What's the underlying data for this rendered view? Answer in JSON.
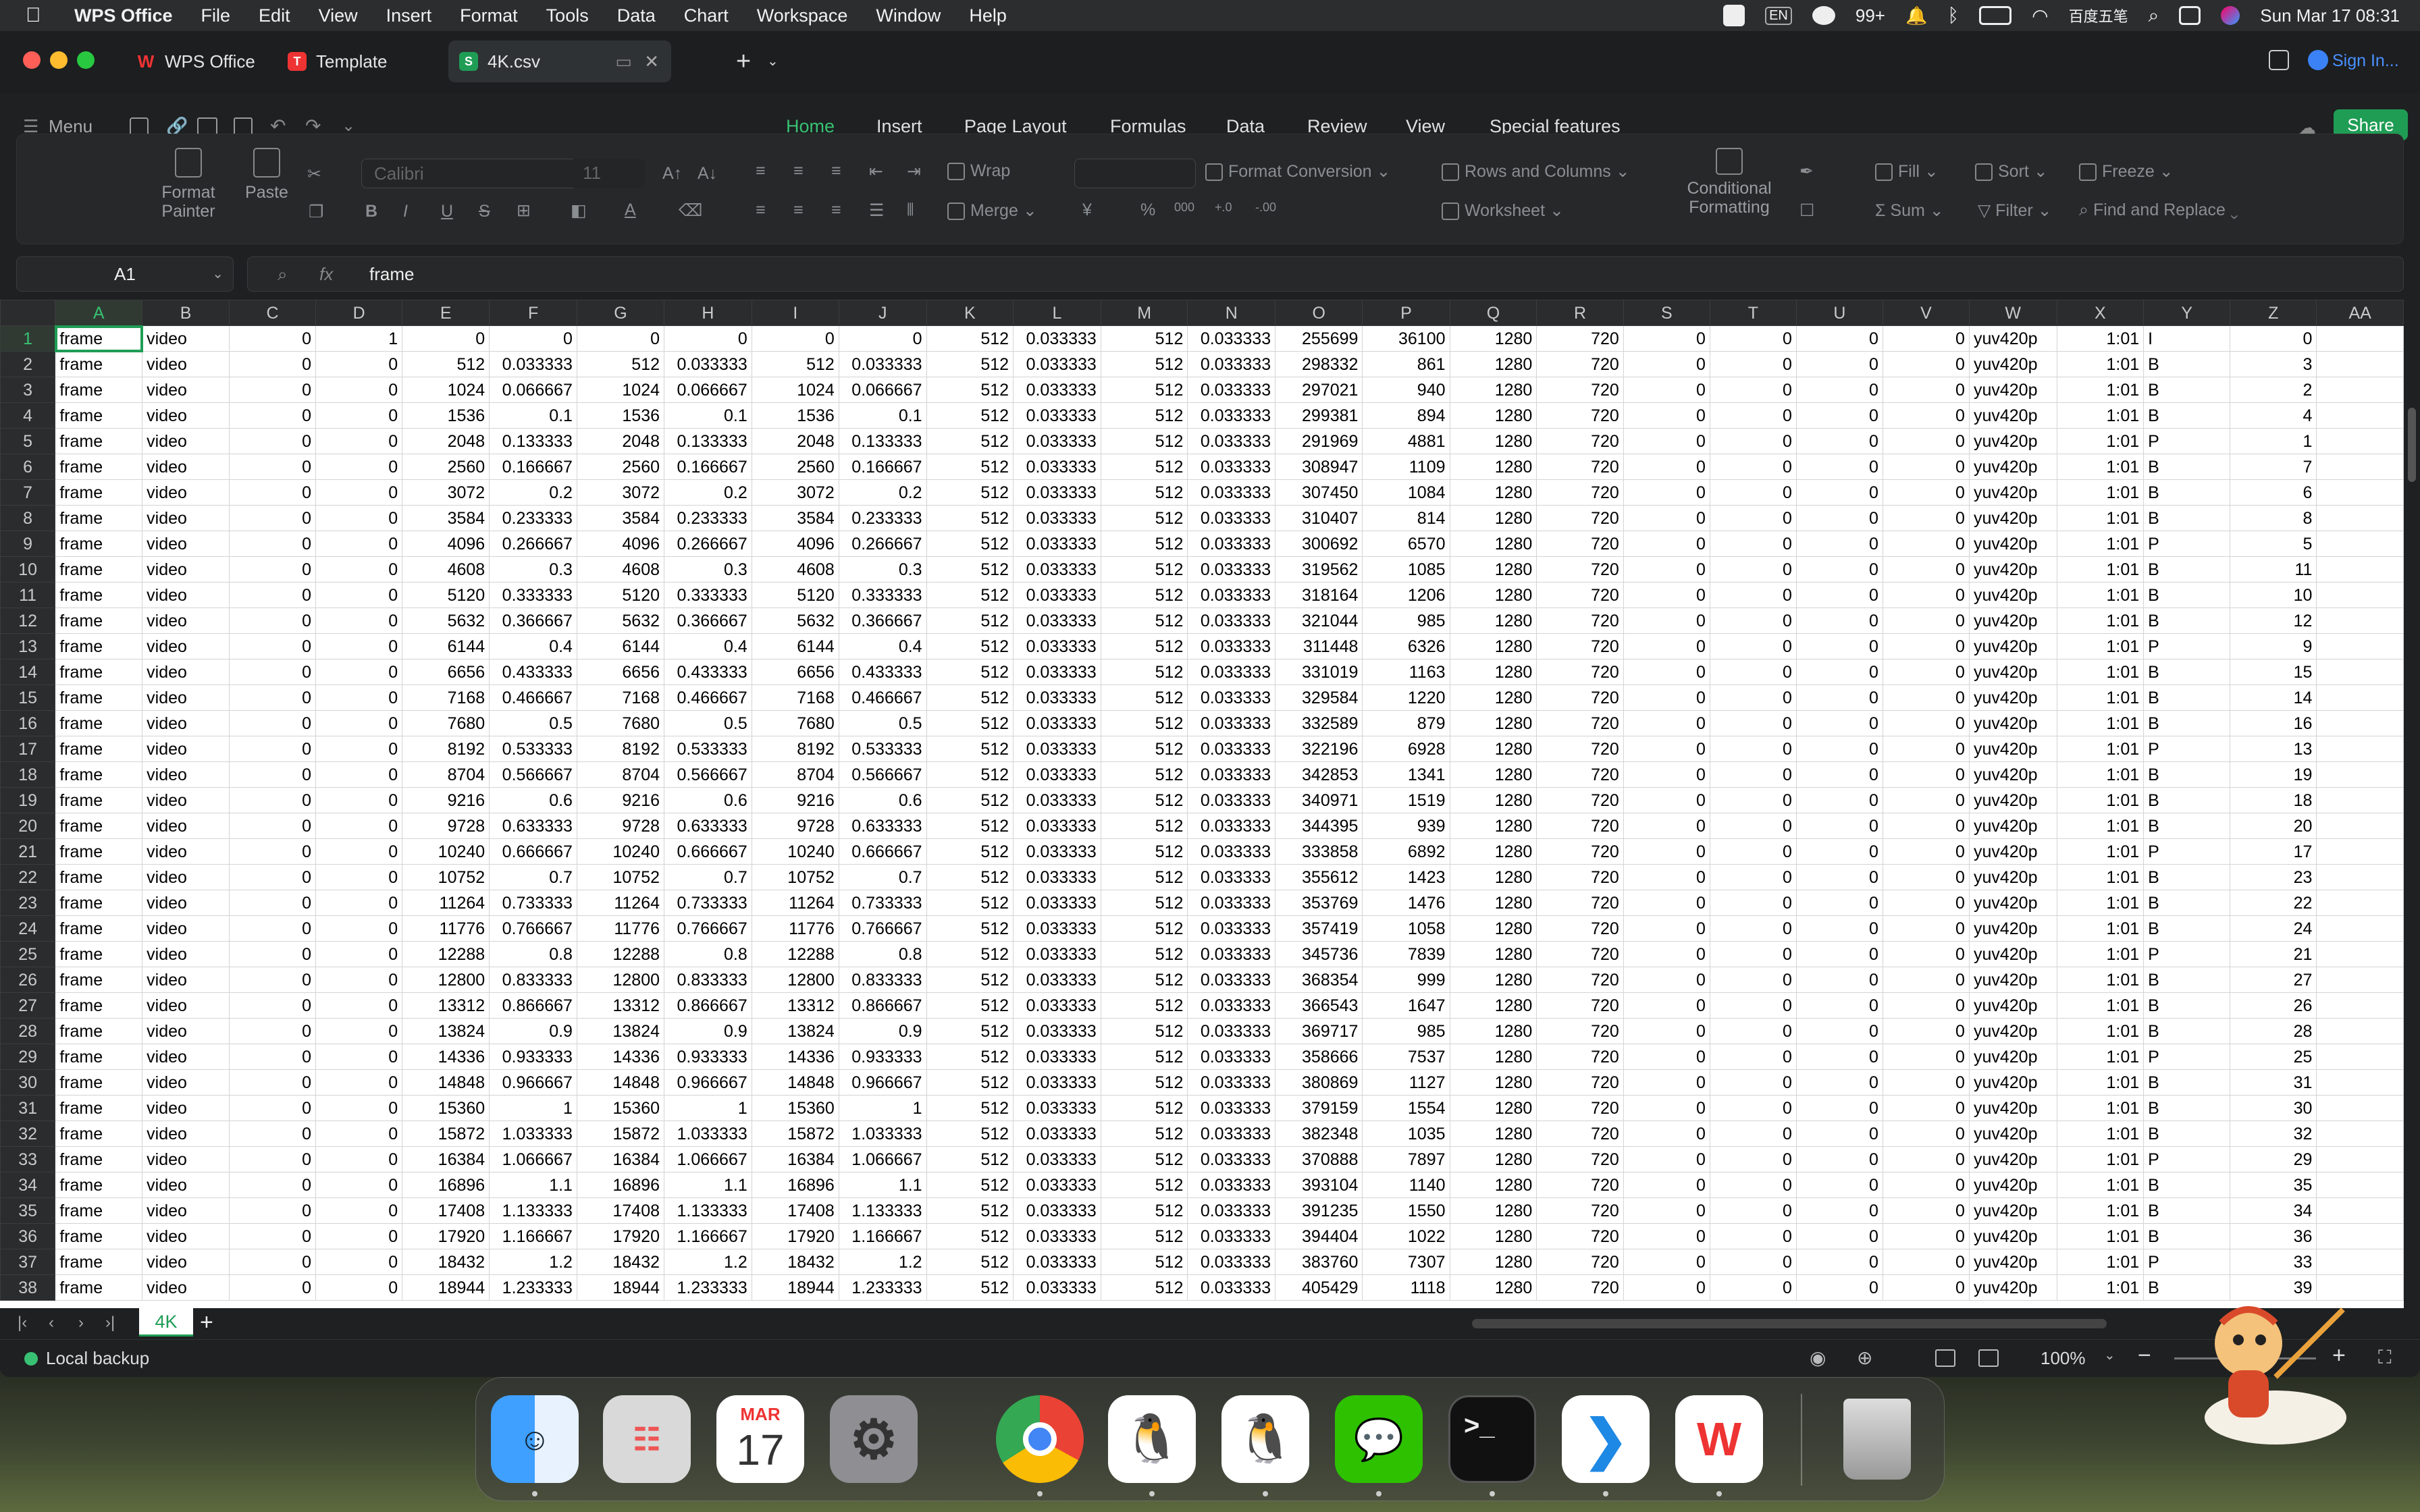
{
  "menubar": {
    "app": "WPS Office",
    "items": [
      "File",
      "Edit",
      "View",
      "Insert",
      "Format",
      "Tools",
      "Data",
      "Chart",
      "Workspace",
      "Window",
      "Help"
    ],
    "status": {
      "input": "EN",
      "badge": "99+",
      "ime": "百度五笔",
      "datetime": "Sun Mar 17  08:31"
    }
  },
  "tabs": {
    "home": "WPS Office",
    "template": "Template",
    "file": "4K.csv",
    "signin": "Sign In..."
  },
  "toolbar": {
    "menu": "Menu",
    "ribbon_tabs": [
      "Home",
      "Insert",
      "Page Layout",
      "Formulas",
      "Data",
      "Review",
      "View",
      "Special features"
    ],
    "share": "Share"
  },
  "ribbon": {
    "format_painter": "Format Painter",
    "paste": "Paste",
    "font": "Calibri",
    "size": "11",
    "wrap": "Wrap",
    "merge": "Merge",
    "format_conversion": "Format Conversion",
    "rows_cols": "Rows and Columns",
    "worksheet": "Worksheet",
    "conditional": "Conditional Formatting",
    "fill": "Fill",
    "sort": "Sort",
    "freeze": "Freeze",
    "sum": "Sum",
    "filter": "Filter",
    "find_replace": "Find and Replace"
  },
  "formula": {
    "cell": "A1",
    "fx": "fx",
    "value": "frame"
  },
  "columns": [
    "A",
    "B",
    "C",
    "D",
    "E",
    "F",
    "G",
    "H",
    "I",
    "J",
    "K",
    "L",
    "M",
    "N",
    "O",
    "P",
    "Q",
    "R",
    "S",
    "T",
    "U",
    "V",
    "W",
    "X",
    "Y",
    "Z",
    "AA"
  ],
  "rows": [
    [
      "frame",
      "video",
      "0",
      "1",
      "0",
      "0",
      "0",
      "0",
      "0",
      "0",
      "512",
      "0.033333",
      "512",
      "0.033333",
      "255699",
      "36100",
      "1280",
      "720",
      "0",
      "0",
      "0",
      "0",
      "yuv420p",
      "1:01",
      "I",
      "0"
    ],
    [
      "frame",
      "video",
      "0",
      "0",
      "512",
      "0.033333",
      "512",
      "0.033333",
      "512",
      "0.033333",
      "512",
      "0.033333",
      "512",
      "0.033333",
      "298332",
      "861",
      "1280",
      "720",
      "0",
      "0",
      "0",
      "0",
      "yuv420p",
      "1:01",
      "B",
      "3"
    ],
    [
      "frame",
      "video",
      "0",
      "0",
      "1024",
      "0.066667",
      "1024",
      "0.066667",
      "1024",
      "0.066667",
      "512",
      "0.033333",
      "512",
      "0.033333",
      "297021",
      "940",
      "1280",
      "720",
      "0",
      "0",
      "0",
      "0",
      "yuv420p",
      "1:01",
      "B",
      "2"
    ],
    [
      "frame",
      "video",
      "0",
      "0",
      "1536",
      "0.1",
      "1536",
      "0.1",
      "1536",
      "0.1",
      "512",
      "0.033333",
      "512",
      "0.033333",
      "299381",
      "894",
      "1280",
      "720",
      "0",
      "0",
      "0",
      "0",
      "yuv420p",
      "1:01",
      "B",
      "4"
    ],
    [
      "frame",
      "video",
      "0",
      "0",
      "2048",
      "0.133333",
      "2048",
      "0.133333",
      "2048",
      "0.133333",
      "512",
      "0.033333",
      "512",
      "0.033333",
      "291969",
      "4881",
      "1280",
      "720",
      "0",
      "0",
      "0",
      "0",
      "yuv420p",
      "1:01",
      "P",
      "1"
    ],
    [
      "frame",
      "video",
      "0",
      "0",
      "2560",
      "0.166667",
      "2560",
      "0.166667",
      "2560",
      "0.166667",
      "512",
      "0.033333",
      "512",
      "0.033333",
      "308947",
      "1109",
      "1280",
      "720",
      "0",
      "0",
      "0",
      "0",
      "yuv420p",
      "1:01",
      "B",
      "7"
    ],
    [
      "frame",
      "video",
      "0",
      "0",
      "3072",
      "0.2",
      "3072",
      "0.2",
      "3072",
      "0.2",
      "512",
      "0.033333",
      "512",
      "0.033333",
      "307450",
      "1084",
      "1280",
      "720",
      "0",
      "0",
      "0",
      "0",
      "yuv420p",
      "1:01",
      "B",
      "6"
    ],
    [
      "frame",
      "video",
      "0",
      "0",
      "3584",
      "0.233333",
      "3584",
      "0.233333",
      "3584",
      "0.233333",
      "512",
      "0.033333",
      "512",
      "0.033333",
      "310407",
      "814",
      "1280",
      "720",
      "0",
      "0",
      "0",
      "0",
      "yuv420p",
      "1:01",
      "B",
      "8"
    ],
    [
      "frame",
      "video",
      "0",
      "0",
      "4096",
      "0.266667",
      "4096",
      "0.266667",
      "4096",
      "0.266667",
      "512",
      "0.033333",
      "512",
      "0.033333",
      "300692",
      "6570",
      "1280",
      "720",
      "0",
      "0",
      "0",
      "0",
      "yuv420p",
      "1:01",
      "P",
      "5"
    ],
    [
      "frame",
      "video",
      "0",
      "0",
      "4608",
      "0.3",
      "4608",
      "0.3",
      "4608",
      "0.3",
      "512",
      "0.033333",
      "512",
      "0.033333",
      "319562",
      "1085",
      "1280",
      "720",
      "0",
      "0",
      "0",
      "0",
      "yuv420p",
      "1:01",
      "B",
      "11"
    ],
    [
      "frame",
      "video",
      "0",
      "0",
      "5120",
      "0.333333",
      "5120",
      "0.333333",
      "5120",
      "0.333333",
      "512",
      "0.033333",
      "512",
      "0.033333",
      "318164",
      "1206",
      "1280",
      "720",
      "0",
      "0",
      "0",
      "0",
      "yuv420p",
      "1:01",
      "B",
      "10"
    ],
    [
      "frame",
      "video",
      "0",
      "0",
      "5632",
      "0.366667",
      "5632",
      "0.366667",
      "5632",
      "0.366667",
      "512",
      "0.033333",
      "512",
      "0.033333",
      "321044",
      "985",
      "1280",
      "720",
      "0",
      "0",
      "0",
      "0",
      "yuv420p",
      "1:01",
      "B",
      "12"
    ],
    [
      "frame",
      "video",
      "0",
      "0",
      "6144",
      "0.4",
      "6144",
      "0.4",
      "6144",
      "0.4",
      "512",
      "0.033333",
      "512",
      "0.033333",
      "311448",
      "6326",
      "1280",
      "720",
      "0",
      "0",
      "0",
      "0",
      "yuv420p",
      "1:01",
      "P",
      "9"
    ],
    [
      "frame",
      "video",
      "0",
      "0",
      "6656",
      "0.433333",
      "6656",
      "0.433333",
      "6656",
      "0.433333",
      "512",
      "0.033333",
      "512",
      "0.033333",
      "331019",
      "1163",
      "1280",
      "720",
      "0",
      "0",
      "0",
      "0",
      "yuv420p",
      "1:01",
      "B",
      "15"
    ],
    [
      "frame",
      "video",
      "0",
      "0",
      "7168",
      "0.466667",
      "7168",
      "0.466667",
      "7168",
      "0.466667",
      "512",
      "0.033333",
      "512",
      "0.033333",
      "329584",
      "1220",
      "1280",
      "720",
      "0",
      "0",
      "0",
      "0",
      "yuv420p",
      "1:01",
      "B",
      "14"
    ],
    [
      "frame",
      "video",
      "0",
      "0",
      "7680",
      "0.5",
      "7680",
      "0.5",
      "7680",
      "0.5",
      "512",
      "0.033333",
      "512",
      "0.033333",
      "332589",
      "879",
      "1280",
      "720",
      "0",
      "0",
      "0",
      "0",
      "yuv420p",
      "1:01",
      "B",
      "16"
    ],
    [
      "frame",
      "video",
      "0",
      "0",
      "8192",
      "0.533333",
      "8192",
      "0.533333",
      "8192",
      "0.533333",
      "512",
      "0.033333",
      "512",
      "0.033333",
      "322196",
      "6928",
      "1280",
      "720",
      "0",
      "0",
      "0",
      "0",
      "yuv420p",
      "1:01",
      "P",
      "13"
    ],
    [
      "frame",
      "video",
      "0",
      "0",
      "8704",
      "0.566667",
      "8704",
      "0.566667",
      "8704",
      "0.566667",
      "512",
      "0.033333",
      "512",
      "0.033333",
      "342853",
      "1341",
      "1280",
      "720",
      "0",
      "0",
      "0",
      "0",
      "yuv420p",
      "1:01",
      "B",
      "19"
    ],
    [
      "frame",
      "video",
      "0",
      "0",
      "9216",
      "0.6",
      "9216",
      "0.6",
      "9216",
      "0.6",
      "512",
      "0.033333",
      "512",
      "0.033333",
      "340971",
      "1519",
      "1280",
      "720",
      "0",
      "0",
      "0",
      "0",
      "yuv420p",
      "1:01",
      "B",
      "18"
    ],
    [
      "frame",
      "video",
      "0",
      "0",
      "9728",
      "0.633333",
      "9728",
      "0.633333",
      "9728",
      "0.633333",
      "512",
      "0.033333",
      "512",
      "0.033333",
      "344395",
      "939",
      "1280",
      "720",
      "0",
      "0",
      "0",
      "0",
      "yuv420p",
      "1:01",
      "B",
      "20"
    ],
    [
      "frame",
      "video",
      "0",
      "0",
      "10240",
      "0.666667",
      "10240",
      "0.666667",
      "10240",
      "0.666667",
      "512",
      "0.033333",
      "512",
      "0.033333",
      "333858",
      "6892",
      "1280",
      "720",
      "0",
      "0",
      "0",
      "0",
      "yuv420p",
      "1:01",
      "P",
      "17"
    ],
    [
      "frame",
      "video",
      "0",
      "0",
      "10752",
      "0.7",
      "10752",
      "0.7",
      "10752",
      "0.7",
      "512",
      "0.033333",
      "512",
      "0.033333",
      "355612",
      "1423",
      "1280",
      "720",
      "0",
      "0",
      "0",
      "0",
      "yuv420p",
      "1:01",
      "B",
      "23"
    ],
    [
      "frame",
      "video",
      "0",
      "0",
      "11264",
      "0.733333",
      "11264",
      "0.733333",
      "11264",
      "0.733333",
      "512",
      "0.033333",
      "512",
      "0.033333",
      "353769",
      "1476",
      "1280",
      "720",
      "0",
      "0",
      "0",
      "0",
      "yuv420p",
      "1:01",
      "B",
      "22"
    ],
    [
      "frame",
      "video",
      "0",
      "0",
      "11776",
      "0.766667",
      "11776",
      "0.766667",
      "11776",
      "0.766667",
      "512",
      "0.033333",
      "512",
      "0.033333",
      "357419",
      "1058",
      "1280",
      "720",
      "0",
      "0",
      "0",
      "0",
      "yuv420p",
      "1:01",
      "B",
      "24"
    ],
    [
      "frame",
      "video",
      "0",
      "0",
      "12288",
      "0.8",
      "12288",
      "0.8",
      "12288",
      "0.8",
      "512",
      "0.033333",
      "512",
      "0.033333",
      "345736",
      "7839",
      "1280",
      "720",
      "0",
      "0",
      "0",
      "0",
      "yuv420p",
      "1:01",
      "P",
      "21"
    ],
    [
      "frame",
      "video",
      "0",
      "0",
      "12800",
      "0.833333",
      "12800",
      "0.833333",
      "12800",
      "0.833333",
      "512",
      "0.033333",
      "512",
      "0.033333",
      "368354",
      "999",
      "1280",
      "720",
      "0",
      "0",
      "0",
      "0",
      "yuv420p",
      "1:01",
      "B",
      "27"
    ],
    [
      "frame",
      "video",
      "0",
      "0",
      "13312",
      "0.866667",
      "13312",
      "0.866667",
      "13312",
      "0.866667",
      "512",
      "0.033333",
      "512",
      "0.033333",
      "366543",
      "1647",
      "1280",
      "720",
      "0",
      "0",
      "0",
      "0",
      "yuv420p",
      "1:01",
      "B",
      "26"
    ],
    [
      "frame",
      "video",
      "0",
      "0",
      "13824",
      "0.9",
      "13824",
      "0.9",
      "13824",
      "0.9",
      "512",
      "0.033333",
      "512",
      "0.033333",
      "369717",
      "985",
      "1280",
      "720",
      "0",
      "0",
      "0",
      "0",
      "yuv420p",
      "1:01",
      "B",
      "28"
    ],
    [
      "frame",
      "video",
      "0",
      "0",
      "14336",
      "0.933333",
      "14336",
      "0.933333",
      "14336",
      "0.933333",
      "512",
      "0.033333",
      "512",
      "0.033333",
      "358666",
      "7537",
      "1280",
      "720",
      "0",
      "0",
      "0",
      "0",
      "yuv420p",
      "1:01",
      "P",
      "25"
    ],
    [
      "frame",
      "video",
      "0",
      "0",
      "14848",
      "0.966667",
      "14848",
      "0.966667",
      "14848",
      "0.966667",
      "512",
      "0.033333",
      "512",
      "0.033333",
      "380869",
      "1127",
      "1280",
      "720",
      "0",
      "0",
      "0",
      "0",
      "yuv420p",
      "1:01",
      "B",
      "31"
    ],
    [
      "frame",
      "video",
      "0",
      "0",
      "15360",
      "1",
      "15360",
      "1",
      "15360",
      "1",
      "512",
      "0.033333",
      "512",
      "0.033333",
      "379159",
      "1554",
      "1280",
      "720",
      "0",
      "0",
      "0",
      "0",
      "yuv420p",
      "1:01",
      "B",
      "30"
    ],
    [
      "frame",
      "video",
      "0",
      "0",
      "15872",
      "1.033333",
      "15872",
      "1.033333",
      "15872",
      "1.033333",
      "512",
      "0.033333",
      "512",
      "0.033333",
      "382348",
      "1035",
      "1280",
      "720",
      "0",
      "0",
      "0",
      "0",
      "yuv420p",
      "1:01",
      "B",
      "32"
    ],
    [
      "frame",
      "video",
      "0",
      "0",
      "16384",
      "1.066667",
      "16384",
      "1.066667",
      "16384",
      "1.066667",
      "512",
      "0.033333",
      "512",
      "0.033333",
      "370888",
      "7897",
      "1280",
      "720",
      "0",
      "0",
      "0",
      "0",
      "yuv420p",
      "1:01",
      "P",
      "29"
    ],
    [
      "frame",
      "video",
      "0",
      "0",
      "16896",
      "1.1",
      "16896",
      "1.1",
      "16896",
      "1.1",
      "512",
      "0.033333",
      "512",
      "0.033333",
      "393104",
      "1140",
      "1280",
      "720",
      "0",
      "0",
      "0",
      "0",
      "yuv420p",
      "1:01",
      "B",
      "35"
    ],
    [
      "frame",
      "video",
      "0",
      "0",
      "17408",
      "1.133333",
      "17408",
      "1.133333",
      "17408",
      "1.133333",
      "512",
      "0.033333",
      "512",
      "0.033333",
      "391235",
      "1550",
      "1280",
      "720",
      "0",
      "0",
      "0",
      "0",
      "yuv420p",
      "1:01",
      "B",
      "34"
    ],
    [
      "frame",
      "video",
      "0",
      "0",
      "17920",
      "1.166667",
      "17920",
      "1.166667",
      "17920",
      "1.166667",
      "512",
      "0.033333",
      "512",
      "0.033333",
      "394404",
      "1022",
      "1280",
      "720",
      "0",
      "0",
      "0",
      "0",
      "yuv420p",
      "1:01",
      "B",
      "36"
    ],
    [
      "frame",
      "video",
      "0",
      "0",
      "18432",
      "1.2",
      "18432",
      "1.2",
      "18432",
      "1.2",
      "512",
      "0.033333",
      "512",
      "0.033333",
      "383760",
      "7307",
      "1280",
      "720",
      "0",
      "0",
      "0",
      "0",
      "yuv420p",
      "1:01",
      "P",
      "33"
    ],
    [
      "frame",
      "video",
      "0",
      "0",
      "18944",
      "1.233333",
      "18944",
      "1.233333",
      "18944",
      "1.233333",
      "512",
      "0.033333",
      "512",
      "0.033333",
      "405429",
      "1118",
      "1280",
      "720",
      "0",
      "0",
      "0",
      "0",
      "yuv420p",
      "1:01",
      "B",
      "39"
    ]
  ],
  "sheet_tab": "4K",
  "status": {
    "backup": "Local backup",
    "zoom": "100%"
  },
  "dock": {
    "calendar_month": "MAR",
    "calendar_day": "17",
    "terminal": ">_"
  },
  "colors": {
    "accent": "#1f9d55",
    "active_tab": "#38c172"
  }
}
